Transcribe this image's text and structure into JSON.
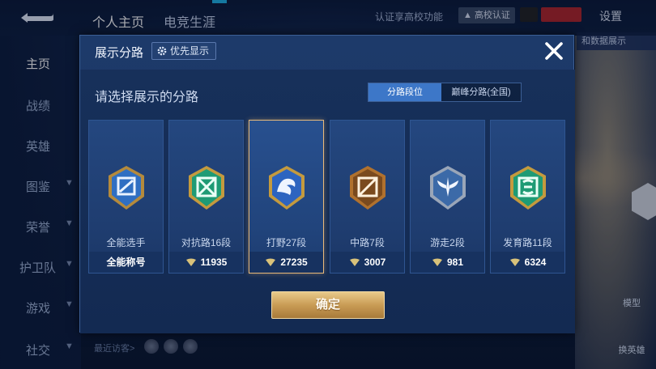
{
  "topbar": {
    "tabs": [
      "个人主页",
      "电竞生涯"
    ],
    "cert_text": "认证享高校功能",
    "cert_badge": "高校认证",
    "settings": "设置"
  },
  "side_nav": {
    "items": [
      "主页",
      "战绩",
      "英雄",
      "图鉴",
      "荣誉",
      "护卫队",
      "游戏",
      "社交"
    ]
  },
  "recent_visitors": "最近访客>",
  "right_panel": {
    "tab": "和数据展示",
    "model": "模型",
    "swap_hero": "换英雄"
  },
  "modal": {
    "title": "展示分路",
    "priority_label": "优先显示",
    "subtitle": "请选择展示的分路",
    "tabs": {
      "active": "分路段位",
      "inactive": "巅峰分路(全国)"
    },
    "cards": [
      {
        "label": "全能选手",
        "value": "全能称号",
        "icon": "all-round-emblem",
        "selected": false
      },
      {
        "label": "对抗路16段",
        "value": "11935",
        "icon": "clash-lane-emblem",
        "selected": false
      },
      {
        "label": "打野27段",
        "value": "27235",
        "icon": "jungle-emblem",
        "selected": true
      },
      {
        "label": "中路7段",
        "value": "3007",
        "icon": "mid-lane-emblem",
        "selected": false
      },
      {
        "label": "游走2段",
        "value": "981",
        "icon": "roam-emblem",
        "selected": false
      },
      {
        "label": "发育路11段",
        "value": "6324",
        "icon": "farm-lane-emblem",
        "selected": false
      }
    ],
    "confirm": "确定"
  },
  "colors": {
    "accent_blue": "#3d77c8",
    "gold": "#c99c55",
    "panel": "#1d3a6a"
  }
}
